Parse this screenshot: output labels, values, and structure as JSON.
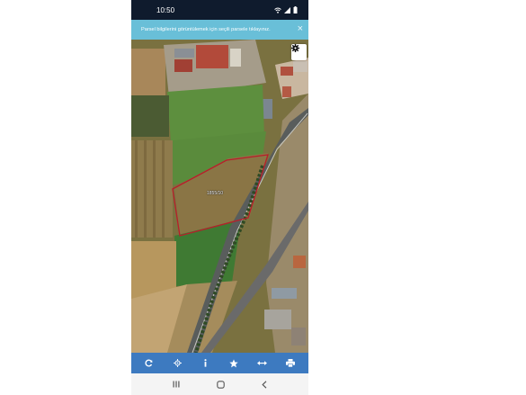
{
  "status_bar": {
    "time": "10:50",
    "icons": [
      "wifi-icon",
      "signal-icon",
      "battery-icon"
    ]
  },
  "banner": {
    "message": "Parsel bilgilerini görüntülemek için seçili parsele tıklayınız.",
    "close_label": "×"
  },
  "map": {
    "parcel_label": "1855/10",
    "parcel_outline_color": "#b81e2a",
    "settings_icon": "gear-icon"
  },
  "toolbar": {
    "background": "#3d7ac0",
    "tools": [
      "refresh-icon",
      "locate-icon",
      "info-icon",
      "favorite-icon",
      "measure-icon",
      "print-icon"
    ]
  },
  "navbar": {
    "buttons": [
      "recent-apps-icon",
      "home-icon",
      "back-icon"
    ]
  }
}
